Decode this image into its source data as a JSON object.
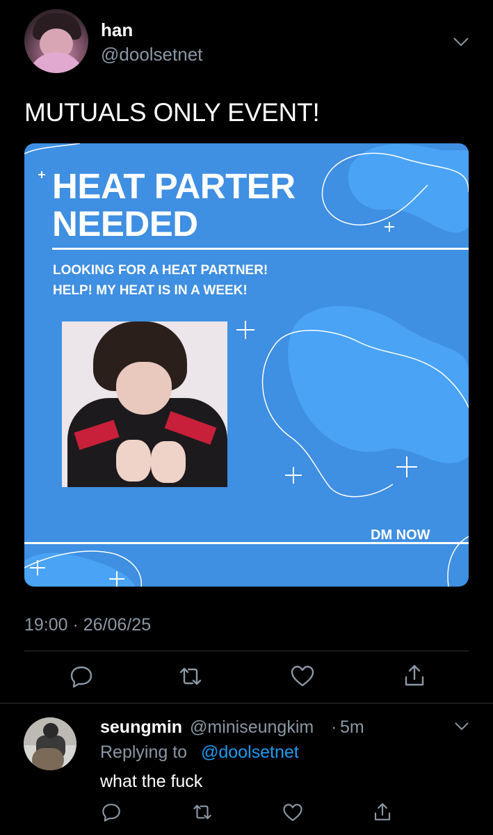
{
  "tweet": {
    "display_name": "han",
    "handle": "@doolsetnet",
    "text": "MUTUALS ONLY EVENT!",
    "timestamp": "19:00 · 26/06/25"
  },
  "card": {
    "headline_line1": "HEAT PARTER",
    "headline_line2": "NEEDED",
    "sub_line1": "LOOKING FOR A HEAT PARTNER!",
    "sub_line2": "HELP! MY HEAT IS IN A WEEK!",
    "cta": "DM NOW",
    "background_color": "#3f8fe2",
    "accent_color": "#4aa3f5"
  },
  "actions": [
    "reply-icon",
    "retweet-icon",
    "like-icon",
    "share-icon"
  ],
  "reply": {
    "display_name": "seungmin",
    "handle": "@miniseungkim",
    "separator": "·",
    "time": "5m",
    "replying_label": "Replying to",
    "replying_handle": "@doolsetnet",
    "text": "what the fuck"
  },
  "colors": {
    "background": "#000000",
    "secondary_text": "#8b98a5",
    "link": "#1d9bf0",
    "divider": "#2f3336"
  }
}
